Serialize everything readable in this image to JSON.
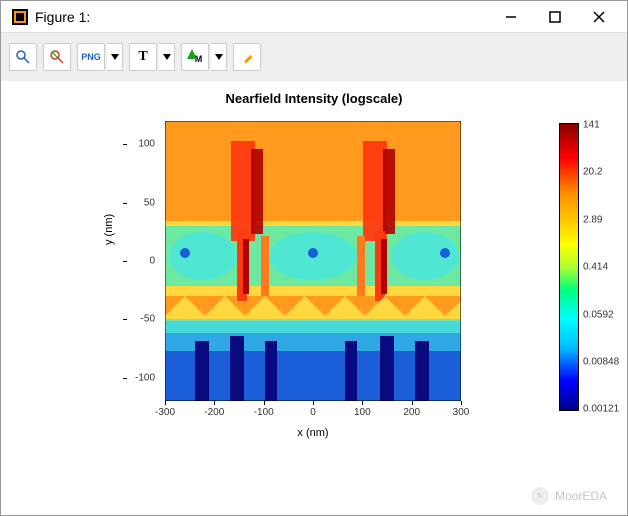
{
  "window": {
    "title": "Figure 1:"
  },
  "toolbar": {
    "zoom": "zoom-in-icon",
    "zoom_reset": "zoom-reset-icon",
    "png": "PNG",
    "text_label": "T",
    "marker_label": "M",
    "pencil": "edit-icon"
  },
  "chart_data": {
    "type": "heatmap",
    "title": "Nearfield Intensity (logscale)",
    "xlabel": "x (nm)",
    "ylabel": "y (nm)",
    "x_range": [
      -300,
      300
    ],
    "y_range": [
      -120,
      120
    ],
    "x_ticks": [
      -300,
      -200,
      -100,
      0,
      100,
      200,
      300
    ],
    "y_ticks": [
      -100,
      -50,
      0,
      50,
      100
    ],
    "colorbar": {
      "scale": "log",
      "min": 0.00121,
      "max": 141,
      "ticks": [
        141,
        20.2,
        2.89,
        0.414,
        0.0592,
        0.00848,
        0.00121
      ],
      "colormap": "jet"
    }
  },
  "watermark": {
    "text": "MoorEDA"
  }
}
